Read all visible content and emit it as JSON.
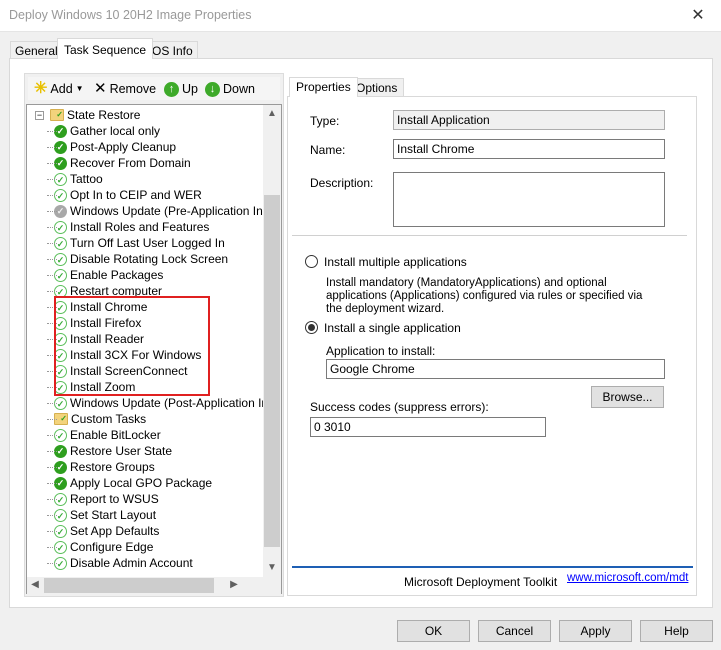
{
  "window": {
    "title": "Deploy Windows 10 20H2 Image Properties",
    "close": "✕"
  },
  "tabs": [
    "General",
    "Task Sequence",
    "OS Info"
  ],
  "toolbar": {
    "add": "Add",
    "remove": "Remove",
    "up": "Up",
    "down": "Down"
  },
  "tree": {
    "group": {
      "label": "State Restore",
      "icon": "folder"
    },
    "items": [
      {
        "label": "Gather local only",
        "icon": "full"
      },
      {
        "label": "Post-Apply Cleanup",
        "icon": "full"
      },
      {
        "label": "Recover From Domain",
        "icon": "full"
      },
      {
        "label": "Tattoo",
        "icon": "light"
      },
      {
        "label": "Opt In to CEIP and WER",
        "icon": "light"
      },
      {
        "label": "Windows Update (Pre-Application Inst",
        "icon": "gray"
      },
      {
        "label": "Install Roles and Features",
        "icon": "light"
      },
      {
        "label": "Turn Off Last User Logged In",
        "icon": "light"
      },
      {
        "label": "Disable Rotating Lock Screen",
        "icon": "light"
      },
      {
        "label": "Enable Packages",
        "icon": "light"
      },
      {
        "label": "Restart computer",
        "icon": "light"
      },
      {
        "label": "Install Chrome",
        "icon": "light"
      },
      {
        "label": "Install Firefox",
        "icon": "light"
      },
      {
        "label": "Install Reader",
        "icon": "light"
      },
      {
        "label": "Install 3CX For Windows",
        "icon": "light"
      },
      {
        "label": "Install ScreenConnect",
        "icon": "light"
      },
      {
        "label": "Install Zoom",
        "icon": "light"
      },
      {
        "label": "Windows Update (Post-Application Ins",
        "icon": "light"
      },
      {
        "label": "Custom Tasks",
        "icon": "folder"
      },
      {
        "label": "Enable BitLocker",
        "icon": "light"
      },
      {
        "label": "Restore User State",
        "icon": "full"
      },
      {
        "label": "Restore Groups",
        "icon": "full"
      },
      {
        "label": "Apply Local GPO Package",
        "icon": "full"
      },
      {
        "label": "Report to WSUS",
        "icon": "light"
      },
      {
        "label": "Set Start Layout",
        "icon": "light"
      },
      {
        "label": "Set App Defaults",
        "icon": "light"
      },
      {
        "label": "Configure Edge",
        "icon": "light"
      },
      {
        "label": "Disable Admin Account",
        "icon": "light"
      }
    ],
    "highlight_color": "#e02020"
  },
  "props": {
    "tabs": [
      "Properties",
      "Options"
    ],
    "type_label": "Type:",
    "type_value": "Install Application",
    "name_label": "Name:",
    "name_value": "Install Chrome",
    "desc_label": "Description:",
    "desc_value": "",
    "radio_multiple": "Install multiple applications",
    "multiple_desc": "Install mandatory (MandatoryApplications) and optional applications (Applications) configured via rules or specified via the deployment wizard.",
    "radio_single": "Install a single application",
    "app_label": "Application to install:",
    "app_value": "Google Chrome",
    "browse": "Browse...",
    "codes_label": "Success codes (suppress errors):",
    "codes_value": "0 3010",
    "footer_text": "Microsoft Deployment Toolkit",
    "footer_link": "www.microsoft.com/mdt",
    "footer_color": "#1e5fb4"
  },
  "buttons": {
    "ok": "OK",
    "cancel": "Cancel",
    "apply": "Apply",
    "help": "Help"
  }
}
